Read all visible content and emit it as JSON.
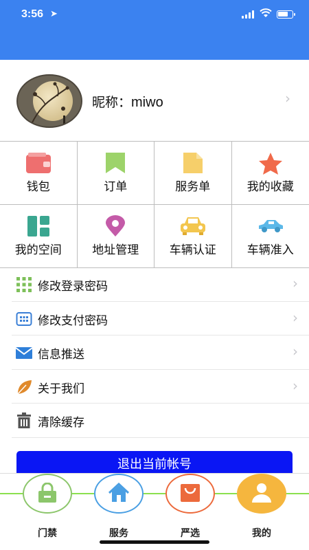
{
  "status_bar": {
    "time": "3:56",
    "location_icon": "location-arrow-icon"
  },
  "profile": {
    "nickname_label": "昵称：",
    "nickname": "miwo"
  },
  "grid": [
    {
      "label": "钱包",
      "icon": "wallet-icon",
      "color": "#ee6f6f"
    },
    {
      "label": "订单",
      "icon": "bookmark-icon",
      "color": "#9dd36a"
    },
    {
      "label": "服务单",
      "icon": "document-icon",
      "color": "#f6cf6a"
    },
    {
      "label": "我的收藏",
      "icon": "star-icon",
      "color": "#f06a4a"
    },
    {
      "label": "我的空间",
      "icon": "layout-icon",
      "color": "#3aa690"
    },
    {
      "label": "地址管理",
      "icon": "location-pin-icon",
      "color": "#c45ba8"
    },
    {
      "label": "车辆认证",
      "icon": "car-front-icon",
      "color": "#f3c64e"
    },
    {
      "label": "车辆准入",
      "icon": "car-side-icon",
      "color": "#5bb8e8"
    }
  ],
  "menu": [
    {
      "label": "修改登录密码",
      "icon": "grid-dots-icon",
      "chevron": true
    },
    {
      "label": "修改支付密码",
      "icon": "keypad-icon",
      "chevron": true
    },
    {
      "label": "信息推送",
      "icon": "mail-icon",
      "chevron": true
    },
    {
      "label": "关于我们",
      "icon": "leaf-icon",
      "chevron": true
    },
    {
      "label": "清除缓存",
      "icon": "trash-icon",
      "chevron": false
    }
  ],
  "logout_label": "退出当前帐号",
  "tabs": [
    {
      "label": "门禁",
      "icon": "lock-icon",
      "color": "#8cc66b"
    },
    {
      "label": "服务",
      "icon": "home-icon",
      "color": "#4a9fe3"
    },
    {
      "label": "严选",
      "icon": "shopping-bag-icon",
      "color": "#ec6a3c"
    },
    {
      "label": "我的",
      "icon": "user-icon",
      "color": "#f5b63e"
    }
  ]
}
